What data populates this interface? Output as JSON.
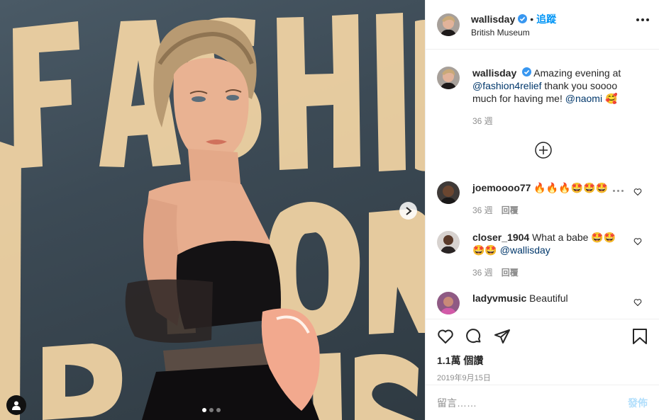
{
  "header": {
    "username": "wallisday",
    "bullet": "•",
    "follow_label": "追蹤",
    "location": "British Museum"
  },
  "caption": {
    "username": "wallisday",
    "text_1": " Amazing evening at ",
    "mention_1": "@fashion4relief",
    "text_2": " thank you soooo much for having me! ",
    "mention_2": "@naomi",
    "emoji": "🥰",
    "time": "36 週"
  },
  "comments": [
    {
      "username": "joemoooo77",
      "text": "🔥🔥🔥🤩🤩🤩",
      "time": "36 週",
      "reply": "回覆"
    },
    {
      "username": "closer_1904",
      "text": "What a babe 🤩🤩🤩🤩 ",
      "mention": "@wallisday",
      "time": "36 週",
      "reply": "回覆"
    },
    {
      "username": "ladyvmusic",
      "text": "Beautiful"
    }
  ],
  "stats": {
    "likes": "1.1萬 個讚",
    "date": "2019年9月15日"
  },
  "add_comment": {
    "placeholder": "留言……",
    "post_label": "發佈"
  },
  "photo": {
    "background_letters": "FASHIO FOR RELIE",
    "carousel_position": 1,
    "carousel_count": 3
  },
  "colors": {
    "accent": "#0095f6",
    "post_disabled": "#b2dffc",
    "muted": "#8e8e8e"
  }
}
